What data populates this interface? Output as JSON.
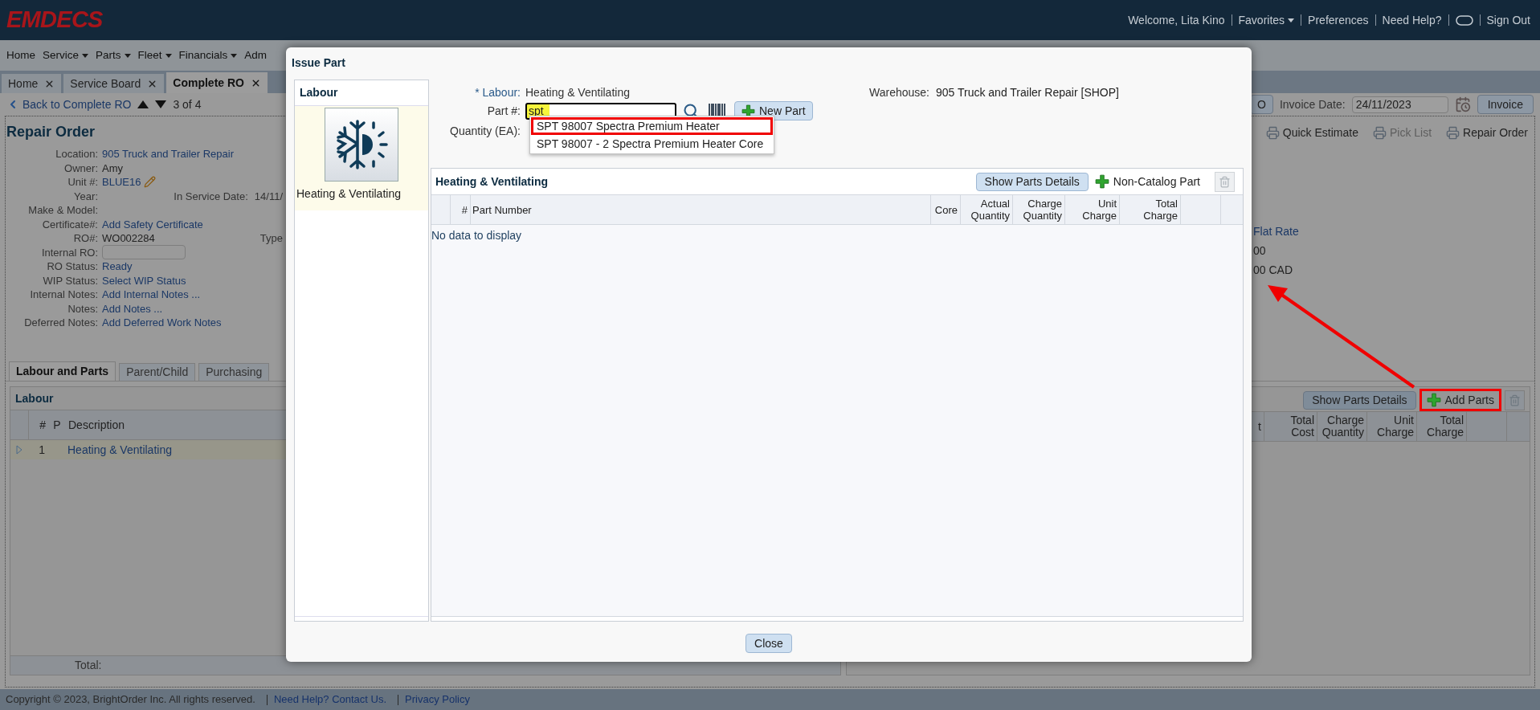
{
  "header": {
    "logo": "EMDECS",
    "welcome": "Welcome, Lita Kino",
    "favorites": "Favorites",
    "preferences": "Preferences",
    "help": "Need Help?",
    "sign_out": "Sign Out"
  },
  "menu": [
    {
      "label": "Home",
      "dropdown": false
    },
    {
      "label": "Service",
      "dropdown": true
    },
    {
      "label": "Parts",
      "dropdown": true
    },
    {
      "label": "Fleet",
      "dropdown": true
    },
    {
      "label": "Financials",
      "dropdown": true
    },
    {
      "label": "Adm",
      "dropdown": false
    }
  ],
  "tabs": [
    {
      "label": "Home",
      "selected": false
    },
    {
      "label": "Service Board",
      "selected": false
    },
    {
      "label": "Complete RO",
      "selected": true
    }
  ],
  "nav": {
    "back": "Back to Complete RO",
    "position": "3 of 4"
  },
  "invoice_bar": {
    "partial_button": "O",
    "date_label": "Invoice Date:",
    "date": "24/11/2023",
    "invoice_button": "Invoice"
  },
  "repair_order": {
    "title": "Repair Order",
    "fields": [
      {
        "label": "Location:",
        "value": "905 Truck and Trailer Repair",
        "kind": "link"
      },
      {
        "label": "Owner:",
        "value": "Amy",
        "kind": "text"
      },
      {
        "label": "Unit #:",
        "value": "BLUE16",
        "kind": "editable"
      },
      {
        "label": "Year:",
        "kind": "empty",
        "extra_label": "In Service Date:",
        "extra_value": "14/11/"
      },
      {
        "label": "Make & Model:",
        "kind": "empty"
      },
      {
        "label": "Certificate#:",
        "value": "Add Safety Certificate",
        "kind": "link"
      },
      {
        "label": "RO#:",
        "value": "WO002284",
        "kind": "text",
        "extra_label": "Type"
      },
      {
        "label": "Internal RO:",
        "kind": "input"
      },
      {
        "label": "RO Status:",
        "value": "Ready",
        "kind": "link"
      },
      {
        "label": "WIP Status:",
        "value": "Select WIP Status",
        "kind": "link"
      },
      {
        "label": "Internal Notes:",
        "value": "Add Internal Notes ...",
        "kind": "link"
      },
      {
        "label": "Notes:",
        "value": "Add Notes ...",
        "kind": "link"
      },
      {
        "label": "Deferred Notes:",
        "value": "Add Deferred Work Notes",
        "kind": "link"
      }
    ]
  },
  "print_links": [
    {
      "label": "Quick Estimate",
      "disabled": false
    },
    {
      "label": "Pick List",
      "disabled": true
    },
    {
      "label": "Repair Order",
      "disabled": false
    }
  ],
  "rate": [
    {
      "text": "Flat Rate",
      "kind": "link"
    },
    {
      "text": "00",
      "kind": "text"
    },
    {
      "text": "00 CAD",
      "kind": "text"
    }
  ],
  "section_tabs": [
    {
      "label": "Labour and Parts",
      "selected": true
    },
    {
      "label": "Parent/Child",
      "selected": false
    },
    {
      "label": "Purchasing",
      "selected": false
    }
  ],
  "labour_panel": {
    "title": "Labour",
    "columns": [
      "#",
      "P",
      "Description"
    ],
    "rows": [
      {
        "number": "1",
        "description": "Heating & Ventilating",
        "selected": true
      }
    ],
    "total_label": "Total:"
  },
  "parts_panel": {
    "show_details": "Show Parts Details",
    "add_parts": {
      "label": "Add Parts",
      "highlighted": true
    },
    "columns": [
      "t",
      "Total Cost",
      "Charge Quantity",
      "Unit Charge",
      "Total Charge"
    ]
  },
  "footer": {
    "copyright": "Copyright © 2023, BrightOrder Inc. All rights reserved.",
    "links": [
      "Need Help? Contact Us.",
      "Privacy Policy"
    ]
  },
  "dialog": {
    "title": "Issue Part",
    "labour_list": {
      "title": "Labour",
      "items": [
        {
          "label": "Heating & Ventilating",
          "selected": true
        }
      ]
    },
    "labour_label": "* Labour:",
    "labour_value": "Heating & Ventilating",
    "part_label": "Part #:",
    "part_value": "spt",
    "new_part": "New Part",
    "quantity_label": "Quantity (EA):",
    "suggestions": [
      {
        "label": "SPT 98007 Spectra Premium Heater",
        "highlighted": true
      },
      {
        "label": "SPT 98007 - 2 Spectra Premium Heater Core",
        "highlighted": false
      }
    ],
    "warehouse_label": "Warehouse:",
    "warehouse_value": "905 Truck and Trailer Repair [SHOP]",
    "grid": {
      "title": "Heating & Ventilating",
      "show_details": "Show Parts Details",
      "non_catalog": "Non-Catalog Part",
      "columns": [
        "#",
        "Part Number",
        "Core",
        "Actual Quantity",
        "Charge Quantity",
        "Unit Charge",
        "Total Charge"
      ],
      "empty": "No data to display"
    },
    "close": "Close"
  }
}
